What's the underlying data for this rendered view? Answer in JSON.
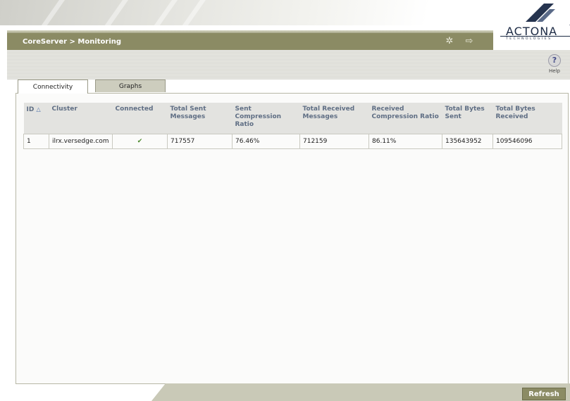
{
  "header": {
    "breadcrumb": "CoreServer > Monitoring",
    "logo_text": "ACTONA",
    "logo_trademark": "TM",
    "logo_subtext": "TECHNOLOGIES"
  },
  "toolbar": {
    "help_label": "Help"
  },
  "tabs": [
    {
      "label": "Connectivity",
      "active": true
    },
    {
      "label": "Graphs",
      "active": false
    }
  ],
  "table": {
    "columns": [
      "ID",
      "Cluster",
      "Connected",
      "Total Sent Messages",
      "Sent Compression Ratio",
      "Total Received Messages",
      "Received Compression Ratio",
      "Total Bytes Sent",
      "Total Bytes Received"
    ],
    "rows": [
      {
        "id": "1",
        "cluster": "ilrx.versedge.com",
        "connected": "✔",
        "total_sent_messages": "717557",
        "sent_compression_ratio": "76.46%",
        "total_received_messages": "712159",
        "received_compression_ratio": "86.11%",
        "total_bytes_sent": "135643952",
        "total_bytes_received": "109546096"
      }
    ]
  },
  "footer": {
    "refresh_label": "Refresh"
  },
  "colors": {
    "header_bar": "#8b8b64",
    "table_header_text": "#5f6e84",
    "check": "#4d8a2e"
  },
  "icons": [
    "wand-icon",
    "logout-icon",
    "help-icon",
    "sort-ascending-icon",
    "check-icon"
  ]
}
